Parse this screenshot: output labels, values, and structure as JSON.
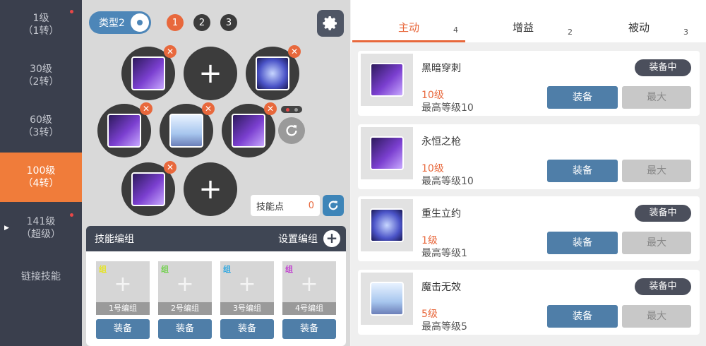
{
  "sidebar": {
    "items": [
      {
        "line1": "1级",
        "line2": "（1转）",
        "active": false,
        "dot": true,
        "arrow": false
      },
      {
        "line1": "30级",
        "line2": "（2转）",
        "active": false,
        "dot": false,
        "arrow": false
      },
      {
        "line1": "60级",
        "line2": "（3转）",
        "active": false,
        "dot": false,
        "arrow": false
      },
      {
        "line1": "100级",
        "line2": "（4转）",
        "active": true,
        "dot": false,
        "arrow": false
      },
      {
        "line1": "141级",
        "line2": "（超级）",
        "active": false,
        "dot": true,
        "arrow": true
      },
      {
        "line1": "链接技能",
        "line2": "",
        "active": false,
        "dot": false,
        "arrow": false
      }
    ]
  },
  "left": {
    "type_label": "类型2",
    "pages": [
      "1",
      "2",
      "3"
    ],
    "skill_points_label": "技能点",
    "skill_points_value": "0",
    "groups_title": "技能编组",
    "groups_setting": "设置编组",
    "group_tag": "组",
    "groups": [
      {
        "label": "1号编组",
        "equip": "装备",
        "tag_color": "#e7e51a"
      },
      {
        "label": "2号编组",
        "equip": "装备",
        "tag_color": "#6fd04a"
      },
      {
        "label": "3号编组",
        "equip": "装备",
        "tag_color": "#2aa6e0"
      },
      {
        "label": "4号编组",
        "equip": "装备",
        "tag_color": "#c03ad0"
      }
    ]
  },
  "tabs": [
    {
      "label": "主动",
      "count": "4",
      "active": true
    },
    {
      "label": "增益",
      "count": "2",
      "active": false
    },
    {
      "label": "被动",
      "count": "3",
      "active": false
    }
  ],
  "skills": [
    {
      "name": "黑暗穿刺",
      "level": "10级",
      "max": "最高等级10",
      "status": "装备中",
      "equip": "装备",
      "maxbtn": "最大",
      "icon": "purple"
    },
    {
      "name": "永恒之枪",
      "level": "10级",
      "max": "最高等级10",
      "status": "",
      "equip": "装备",
      "maxbtn": "最大",
      "icon": "purple"
    },
    {
      "name": "重生立约",
      "level": "1级",
      "max": "最高等级1",
      "status": "装备中",
      "equip": "装备",
      "maxbtn": "最大",
      "icon": "blue"
    },
    {
      "name": "魔击无效",
      "level": "5级",
      "max": "最高等级5",
      "status": "装备中",
      "equip": "装备",
      "maxbtn": "最大",
      "icon": "pale"
    }
  ],
  "colors": {
    "accent": "#f07c3a",
    "sidebar_bg": "#3a3f4d",
    "button_blue": "#4f7ea8"
  }
}
